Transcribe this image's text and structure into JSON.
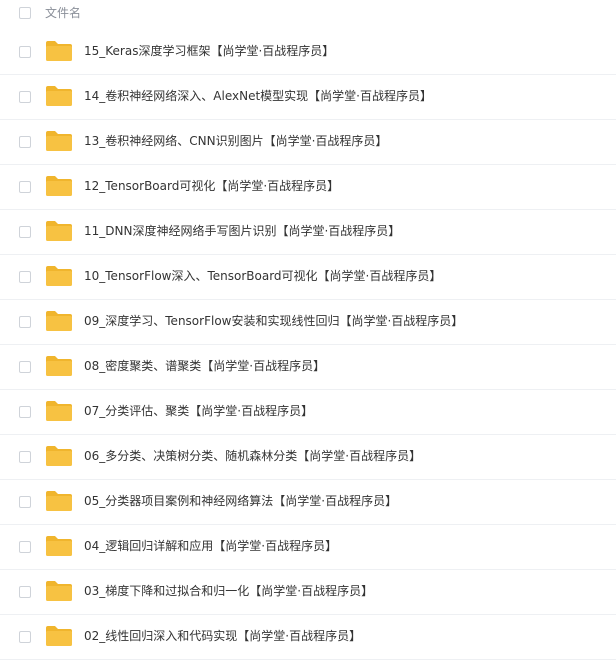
{
  "header": {
    "name_label": "文件名"
  },
  "files": [
    {
      "name": "15_Keras深度学习框架【尚学堂·百战程序员】"
    },
    {
      "name": "14_卷积神经网络深入、AlexNet模型实现【尚学堂·百战程序员】"
    },
    {
      "name": "13_卷积神经网络、CNN识别图片【尚学堂·百战程序员】"
    },
    {
      "name": "12_TensorBoard可视化【尚学堂·百战程序员】"
    },
    {
      "name": "11_DNN深度神经网络手写图片识别【尚学堂·百战程序员】"
    },
    {
      "name": "10_TensorFlow深入、TensorBoard可视化【尚学堂·百战程序员】"
    },
    {
      "name": "09_深度学习、TensorFlow安装和实现线性回归【尚学堂·百战程序员】"
    },
    {
      "name": "08_密度聚类、谱聚类【尚学堂·百战程序员】"
    },
    {
      "name": "07_分类评估、聚类【尚学堂·百战程序员】"
    },
    {
      "name": "06_多分类、决策树分类、随机森林分类【尚学堂·百战程序员】"
    },
    {
      "name": "05_分类器项目案例和神经网络算法【尚学堂·百战程序员】"
    },
    {
      "name": "04_逻辑回归详解和应用【尚学堂·百战程序员】"
    },
    {
      "name": "03_梯度下降和过拟合和归一化【尚学堂·百战程序员】"
    },
    {
      "name": "02_线性回归深入和代码实现【尚学堂·百战程序员】"
    }
  ],
  "colors": {
    "folder": "#f7c242",
    "folder_tab": "#f0b52d"
  },
  "icons": {
    "folder": "folder-icon",
    "checkbox": "checkbox-icon"
  }
}
